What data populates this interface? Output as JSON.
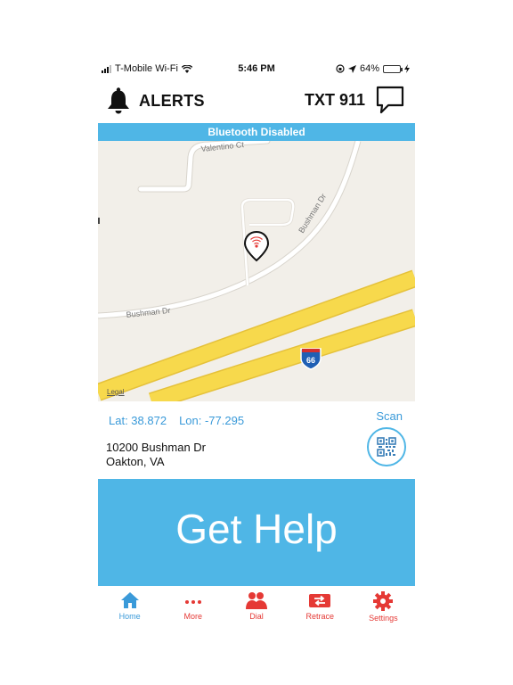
{
  "status_bar": {
    "carrier": "T-Mobile Wi-Fi",
    "time": "5:46 PM",
    "battery": "64%",
    "battery_level": 0.64
  },
  "header": {
    "alerts_label": "ALERTS",
    "txt911_label": "TXT 911"
  },
  "banner": {
    "text": "Bluetooth Disabled"
  },
  "map": {
    "street_labels": [
      "Valentino Ct",
      "Bushman Dr",
      "Bushman Dr"
    ],
    "highway_shield": "66",
    "legal": "Legal"
  },
  "location": {
    "lat": "Lat: 38.872",
    "lon": "Lon: -77.295",
    "address_line1": "10200 Bushman Dr",
    "address_line2": "Oakton, VA",
    "scan_label": "Scan"
  },
  "get_help_label": "Get Help",
  "tabs": [
    {
      "label": "Home"
    },
    {
      "label": "More"
    },
    {
      "label": "Dial"
    },
    {
      "label": "Retrace"
    },
    {
      "label": "Settings"
    }
  ],
  "colors": {
    "accent_blue": "#4fb6e6",
    "tab_red": "#e53935",
    "highway_yellow": "#f7d94c"
  }
}
